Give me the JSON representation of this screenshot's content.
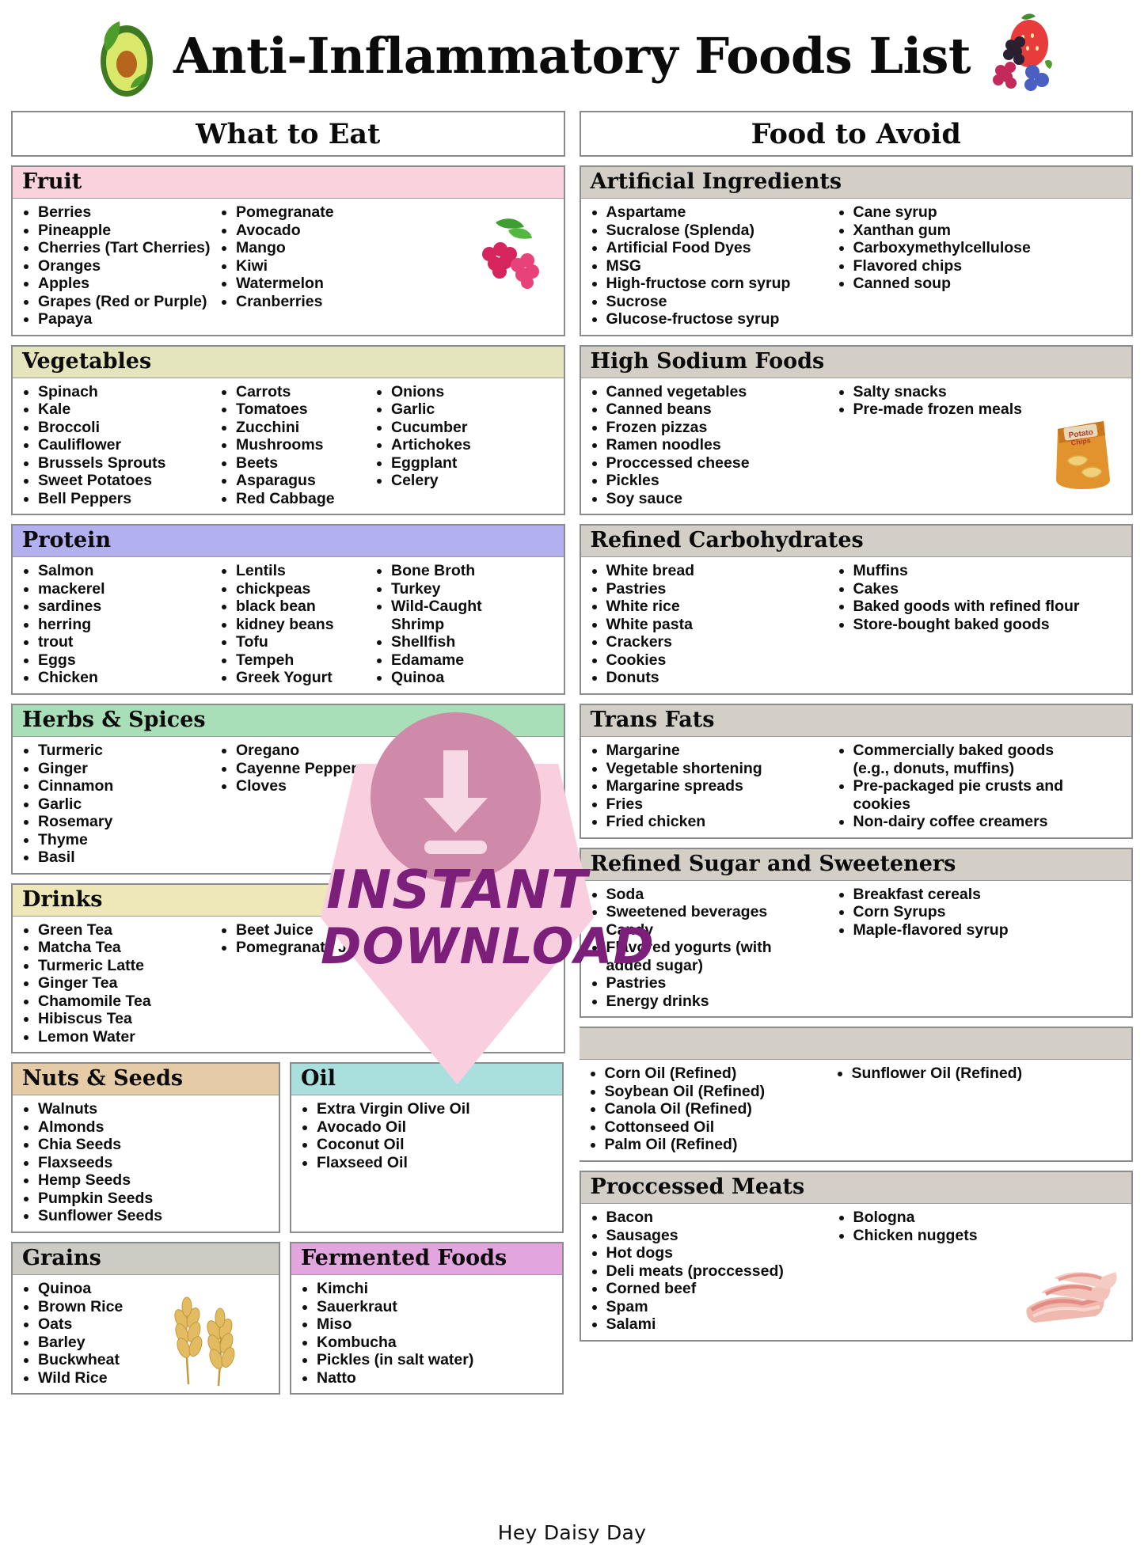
{
  "header": {
    "title": "Anti-Inflammatory Foods List",
    "left_icon": "avocado-icon",
    "right_icon": "berries-icon"
  },
  "columns": [
    {
      "id": "what-to-eat",
      "heading": "What to Eat",
      "sections": [
        {
          "id": "fruit",
          "title": "Fruit",
          "color": "#f9d2de",
          "decoration": "raspberry-icon",
          "lists": [
            [
              "Berries",
              "Pineapple",
              "Cherries (Tart Cherries)",
              "Oranges",
              "Apples",
              "Grapes (Red or Purple)",
              "Papaya"
            ],
            [
              "Pomegranate",
              "Avocado",
              "Mango",
              "Kiwi",
              "Watermelon",
              "Cranberries"
            ]
          ]
        },
        {
          "id": "vegetables",
          "title": "Vegetables",
          "color": "#e4e4bd",
          "lists": [
            [
              "Spinach",
              "Kale",
              "Broccoli",
              "Cauliflower",
              "Brussels Sprouts",
              "Sweet Potatoes",
              "Bell Peppers"
            ],
            [
              "Carrots",
              "Tomatoes",
              "Zucchini",
              "Mushrooms",
              "Beets",
              "Asparagus",
              "Red Cabbage"
            ],
            [
              "Onions",
              "Garlic",
              "Cucumber",
              "Artichokes",
              "Eggplant",
              "Celery"
            ]
          ]
        },
        {
          "id": "protein",
          "title": "Protein",
          "color": "#b3b0f0",
          "lists": [
            [
              "Salmon",
              "mackerel",
              "sardines",
              "herring",
              "trout",
              "Eggs",
              "Chicken"
            ],
            [
              "Lentils",
              "chickpeas",
              "black bean",
              "kidney beans",
              "Tofu",
              "Tempeh",
              "Greek Yogurt"
            ],
            [
              "Bone Broth",
              "Turkey",
              "Wild-Caught Shrimp",
              "Shellfish",
              "Edamame",
              "Quinoa"
            ]
          ]
        },
        {
          "id": "herbs-spices",
          "title": "Herbs & Spices",
          "color": "#a8dfb8",
          "lists": [
            [
              "Turmeric",
              "Ginger",
              "Cinnamon",
              "Garlic",
              "Rosemary",
              "Thyme",
              "Basil"
            ],
            [
              "Oregano",
              "Cayenne Pepper",
              "Cloves"
            ]
          ]
        },
        {
          "id": "drinks",
          "title": "Drinks",
          "color": "#eee8b8",
          "lists": [
            [
              "Green Tea",
              "Matcha Tea",
              "Turmeric Latte",
              "Ginger Tea",
              "Chamomile Tea",
              "Hibiscus Tea",
              "Lemon Water"
            ],
            [
              "Beet Juice",
              "Pomegranate Juice"
            ]
          ]
        }
      ],
      "pair_rows": [
        {
          "left": {
            "id": "nuts-seeds",
            "title": "Nuts & Seeds",
            "color": "#e6cba7",
            "lists": [
              [
                "Walnuts",
                "Almonds",
                "Chia Seeds",
                "Flaxseeds",
                "Hemp Seeds",
                "Pumpkin Seeds",
                "Sunflower Seeds"
              ]
            ]
          }
        },
        {
          "left": {
            "id": "grains",
            "title": "Grains",
            "color": "#cdccc4",
            "decoration": "wheat-icon",
            "lists": [
              [
                "Quinoa",
                "Brown Rice",
                "Oats",
                "Barley",
                "Buckwheat",
                "Wild Rice"
              ]
            ]
          }
        }
      ]
    },
    {
      "id": "food-to-avoid",
      "heading": "Food to Avoid",
      "sections": [
        {
          "id": "artificial-ingredients",
          "title": "Artificial Ingredients",
          "color": "#d3cfc6",
          "lists": [
            [
              "Aspartame",
              "Sucralose (Splenda)",
              "Artificial Food Dyes",
              "MSG",
              "High-fructose corn syrup",
              "Sucrose",
              "Glucose-fructose syrup"
            ],
            [
              "Cane syrup",
              "Xanthan gum",
              "Carboxymethylcellulose",
              "Flavored chips",
              "Canned soup"
            ]
          ]
        },
        {
          "id": "high-sodium-foods",
          "title": "High Sodium Foods",
          "color": "#d3cfc6",
          "decoration": "chips-icon",
          "lists": [
            [
              "Canned vegetables",
              "Canned beans",
              "Frozen pizzas",
              "Ramen noodles",
              "Proccessed cheese",
              "Pickles",
              "Soy sauce"
            ],
            [
              "Salty snacks",
              "Pre-made frozen meals"
            ]
          ]
        },
        {
          "id": "refined-carbohydrates",
          "title": "Refined Carbohydrates",
          "color": "#d3cfc6",
          "lists": [
            [
              "White bread",
              "Pastries",
              "White rice",
              "White pasta",
              "Crackers",
              "Cookies",
              "Donuts"
            ],
            [
              "Muffins",
              "Cakes",
              "Baked goods with refined flour",
              "Store-bought baked goods"
            ]
          ]
        },
        {
          "id": "trans-fats",
          "title": "Trans Fats",
          "color": "#d3cfc6",
          "lists": [
            [
              "Margarine",
              "Vegetable shortening",
              "Margarine spreads",
              "Fries",
              "Fried chicken"
            ],
            [
              "Commercially baked goods (e.g., donuts, muffins)",
              "Pre-packaged pie crusts and cookies",
              "Non-dairy coffee creamers"
            ]
          ]
        },
        {
          "id": "refined-sugar-sweeteners",
          "title": "Refined Sugar and Sweeteners",
          "color": "#d3cfc6",
          "lists": [
            [
              "Soda",
              "Sweetened beverages",
              "Candy",
              "Flavored yogurts (with added sugar)",
              "Pastries",
              "Energy drinks"
            ],
            [
              "Breakfast cereals",
              "Corn Syrups",
              "Maple-flavored syrup"
            ]
          ]
        }
      ],
      "pair_rows": [
        {
          "right": {
            "id": "oil",
            "title": "Oil",
            "color": "#a9dfdc",
            "lists": [
              [
                "Extra Virgin Olive Oil",
                "Avocado Oil",
                "Coconut Oil",
                "Flaxseed Oil"
              ],
              [
                "Corn Oil (Refined)",
                "Soybean Oil (Refined)",
                "Canola Oil (Refined)",
                "Cottonseed Oil",
                "Palm Oil (Refined)"
              ],
              [
                "Sunflower Oil (Refined)"
              ]
            ]
          }
        },
        {
          "right": {
            "id": "fermented-foods",
            "title": "Fermented Foods",
            "color": "#e3a5dd",
            "lists": [
              [
                "Kimchi",
                "Sauerkraut",
                "Miso",
                "Kombucha",
                "Pickles (in salt water)",
                "Natto"
              ]
            ]
          },
          "far_right": {
            "id": "processed-meats",
            "title": "Proccessed Meats",
            "color": "#d3cfc6",
            "decoration": "bacon-icon",
            "lists": [
              [
                "Bacon",
                "Sausages",
                "Hot dogs",
                "Deli meats (proccessed)",
                "Corned beef",
                "Spam",
                "Salami"
              ],
              [
                "Bologna",
                "Chicken nuggets"
              ]
            ]
          }
        }
      ]
    }
  ],
  "watermark": {
    "line1": "INSTANT",
    "line2": "DOWNLOAD",
    "icon": "download-arrow-icon",
    "badge_color": "#cf8aa9",
    "polygon_color": "#f9cfe0",
    "text_color": "#7b1f7b"
  },
  "footer": {
    "brand": "Hey Daisy Day"
  }
}
